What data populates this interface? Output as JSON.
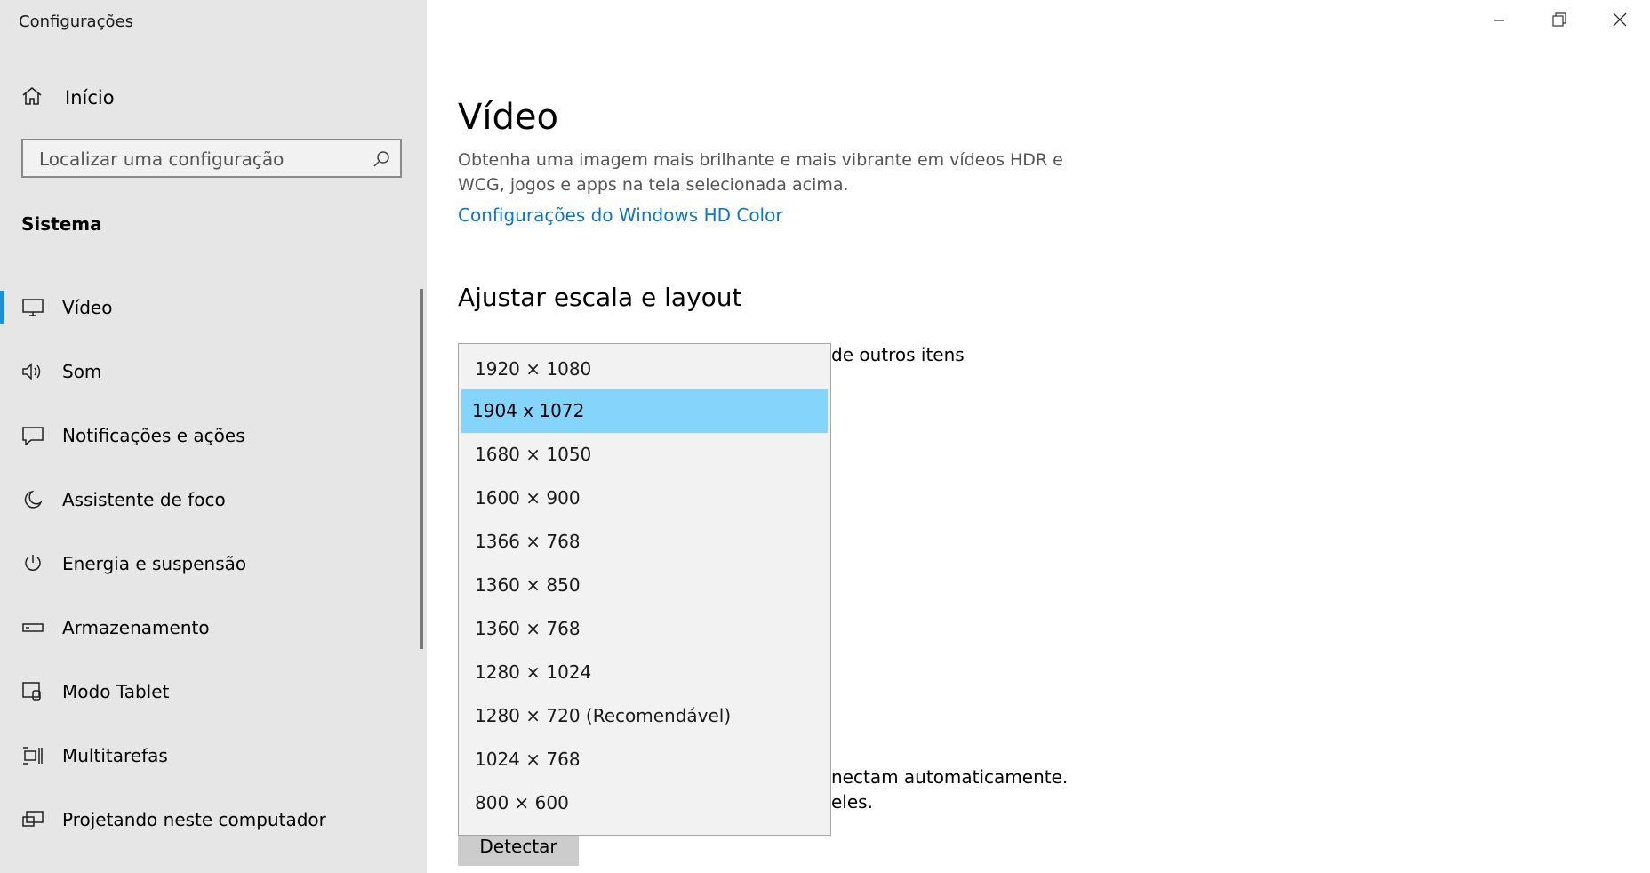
{
  "window": {
    "title": "Configurações",
    "controls": [
      "minimize-icon",
      "restore-icon",
      "close-icon"
    ]
  },
  "sidebar": {
    "home_label": "Início",
    "search_placeholder": "Localizar uma configuração",
    "section_title": "Sistema",
    "items": [
      {
        "label": "Vídeo",
        "icon": "monitor-icon",
        "selected": true
      },
      {
        "label": "Som",
        "icon": "speaker-icon"
      },
      {
        "label": "Notificações e ações",
        "icon": "notification-icon"
      },
      {
        "label": "Assistente de foco",
        "icon": "moon-icon"
      },
      {
        "label": "Energia e suspensão",
        "icon": "power-icon"
      },
      {
        "label": "Armazenamento",
        "icon": "storage-icon"
      },
      {
        "label": "Modo Tablet",
        "icon": "tablet-icon"
      },
      {
        "label": "Multitarefas",
        "icon": "multitask-icon"
      },
      {
        "label": "Projetando neste computador",
        "icon": "projector-icon"
      }
    ],
    "accent_color": "#1e90d6"
  },
  "main": {
    "title": "Vídeo",
    "description": "Obtenha uma imagem mais brilhante e mais vibrante em vídeos HDR e WCG, jogos e apps na tela selecionada acima.",
    "hd_color_link": "Configurações do Windows HD Color",
    "scale_heading": "Ajustar escala e layout",
    "partial_text_1": "de outros itens",
    "partial_text_2": "nectam automaticamente.",
    "partial_text_3": "eles.",
    "detect_button": "Detectar"
  },
  "resolution_dropdown": {
    "options": [
      "1920 × 1080",
      "1904 x 1072",
      "1680 × 1050",
      "1600 × 900",
      "1366 × 768",
      "1360 × 850",
      "1360 × 768",
      "1280 × 1024",
      "1280 × 720 (Recomendável)",
      "1024 × 768",
      "800 × 600"
    ],
    "selected": "1904 x 1072",
    "highlight_color": "#84d4fb"
  }
}
